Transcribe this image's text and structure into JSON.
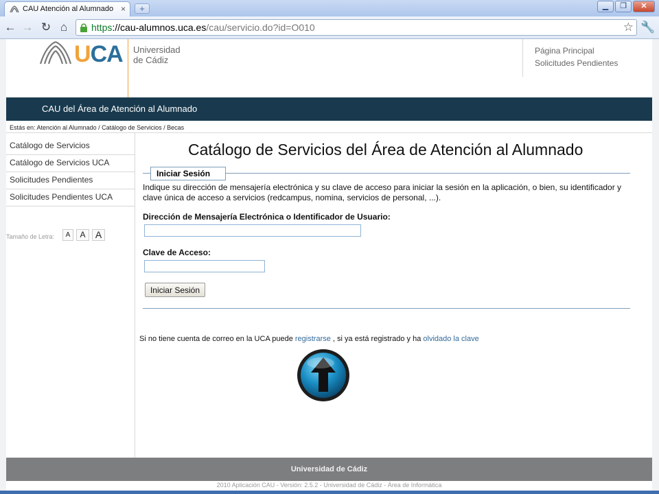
{
  "browser": {
    "tab_title": "CAU Atención al Alumnado - Ir",
    "tab_close": "×",
    "new_tab": "+",
    "url_scheme": "https",
    "url_sep": "://",
    "url_host": "cau-alumnos.uca.es",
    "url_path": "/cau/servicio.do?id=O010"
  },
  "header": {
    "logo_u": "U",
    "logo_ca": "CA",
    "logo_name_1": "Universidad",
    "logo_name_2": "de Cádiz",
    "links": [
      "Página Principal",
      "Solicitudes Pendientes"
    ],
    "banner": "CAU del Área de Atención al Alumnado",
    "breadcrumb": "Estás en: Atención al Alumnado / Catálogo de Servicios / Becas"
  },
  "sidebar": {
    "items": [
      "Catálogo de Servicios",
      "Catálogo de Servicios UCA",
      "Solicitudes Pendientes",
      "Solicitudes Pendientes UCA"
    ],
    "font_size_label": "Tamaño de Letra:",
    "font_size_buttons": [
      "A",
      "A",
      "A"
    ]
  },
  "main": {
    "title": "Catálogo de Servicios del Área de Atención al Alumnado",
    "legend": "Iniciar Sesión",
    "intro": "Indique su dirección de mensajería electrónica y su clave de acceso para iniciar la sesión en la aplicación, o bien, su identificador y clave única de acceso a servicios (redcampus, nomina, servicios de personal, ...).",
    "email_label": "Dirección de Mensajería Electrónica o Identificador de Usuario:",
    "email_value": "",
    "password_label": "Clave de Acceso:",
    "password_value": "",
    "submit_label": "Iniciar Sesión",
    "help_prefix": "Si no tiene cuenta de correo en la UCA puede",
    "help_register": "registrarse",
    "help_middle": ", si ya está registrado y ha",
    "help_forgot": "olvidado la clave"
  },
  "footer": {
    "title": "Universidad de Cádiz",
    "copyright": "2010 Aplicación CAU - Versión: 2.5.2 - Universidad de Cádiz - Área de Informática"
  },
  "colors": {
    "banner": "#193a4e",
    "logo_orange": "#f0a33a",
    "logo_blue": "#2b6f9c",
    "link": "#346a9a",
    "footer": "#7d7e80"
  },
  "icons": [
    "tab-favicon",
    "back-arrow-icon",
    "forward-arrow-icon",
    "reload-icon",
    "home-icon",
    "lock-icon",
    "star-icon",
    "wrench-icon",
    "up-arrow-icon"
  ]
}
